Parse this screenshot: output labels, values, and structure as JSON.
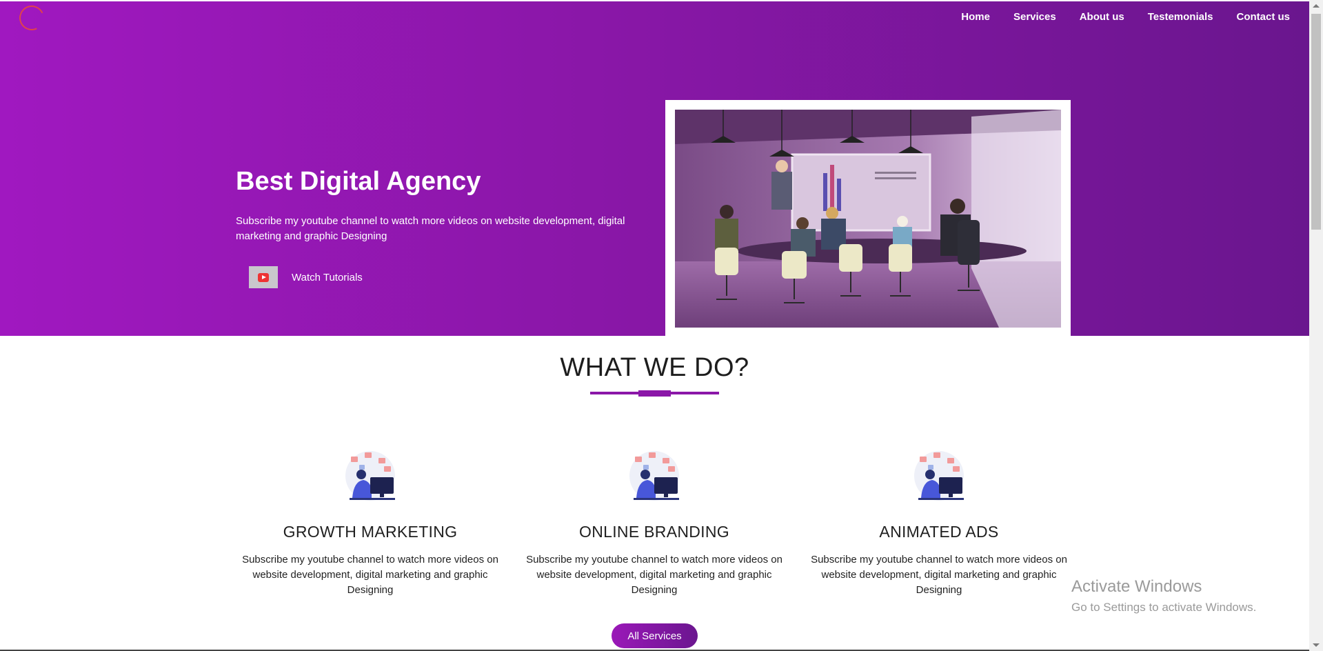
{
  "header": {
    "logo": "spinner-logo",
    "nav": [
      "Home",
      "Services",
      "About us",
      "Testemonials",
      "Contact us"
    ]
  },
  "hero": {
    "title": "Best Digital Agency",
    "text": "Subscribe my youtube channel to watch more videos on website development, digital marketing and graphic Designing",
    "watch_label": "Watch Tutorials",
    "watch_icon": "youtube-play-icon",
    "image": "meeting-room-illustration"
  },
  "services_section": {
    "title": "WHAT WE DO?",
    "items": [
      {
        "name": "GROWTH MARKETING",
        "text": "Subscribe my youtube channel to watch more videos on website development, digital marketing and graphic Designing",
        "icon": "person-at-computer-icon"
      },
      {
        "name": "ONLINE BRANDING",
        "text": "Subscribe my youtube channel to watch more videos on website development, digital marketing and graphic Designing",
        "icon": "person-at-computer-icon"
      },
      {
        "name": "ANIMATED ADS",
        "text": "Subscribe my youtube channel to watch more videos on website development, digital marketing and graphic Designing",
        "icon": "person-at-computer-icon"
      }
    ],
    "button_label": "All Services"
  },
  "overlay": {
    "activate_title": "Activate Windows",
    "activate_subtitle": "Go to Settings to activate Windows."
  },
  "colors": {
    "hero_start": "#a018c0",
    "hero_end": "#6a168e",
    "accent": "#8b17a8",
    "logo_ring": "#e0434b",
    "youtube_red": "#e33333"
  }
}
